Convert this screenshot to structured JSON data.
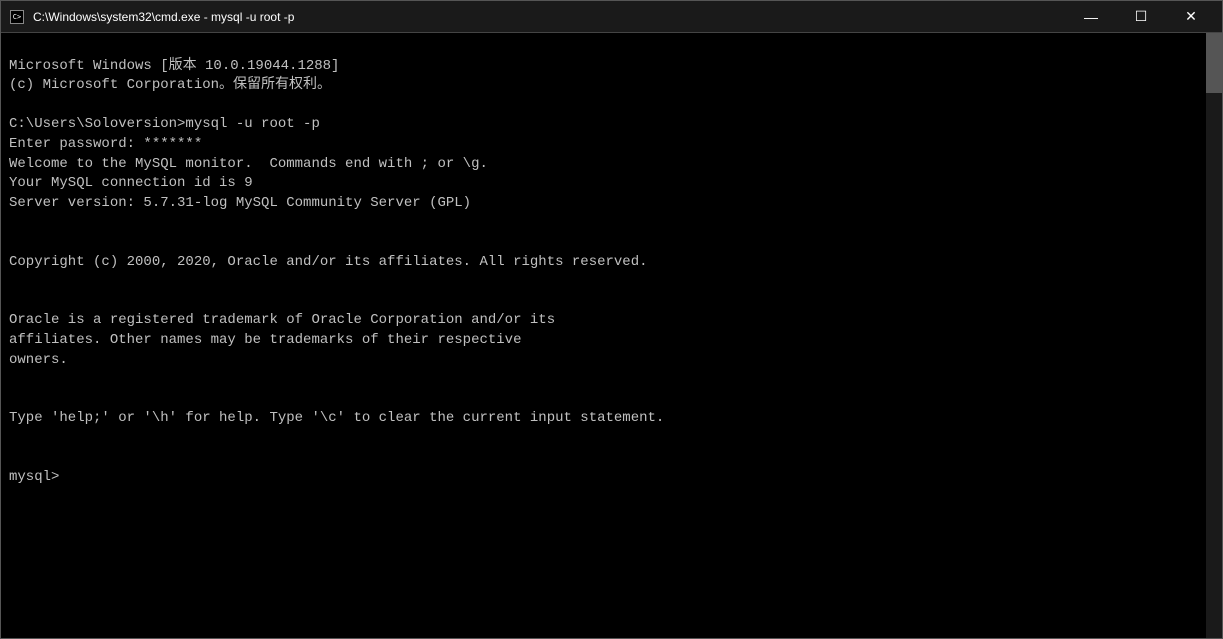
{
  "window": {
    "title": "C:\\Windows\\system32\\cmd.exe - mysql  -u root -p",
    "min_btn": "—",
    "max_btn": "☐",
    "close_btn": "✕"
  },
  "terminal": {
    "lines": [
      {
        "text": "Microsoft Windows [版本 10.0.19044.1288]",
        "type": "normal"
      },
      {
        "text": "(c) Microsoft Corporation。保留所有权利。",
        "type": "normal"
      },
      {
        "text": "",
        "type": "normal"
      },
      {
        "text": "C:\\Users\\Soloversion>mysql -u root -p",
        "type": "normal"
      },
      {
        "text": "Enter password: *******",
        "type": "normal"
      },
      {
        "text": "Welcome to the MySQL monitor.  Commands end with ; or \\g.",
        "type": "normal"
      },
      {
        "text": "Your MySQL connection id is 9",
        "type": "normal"
      },
      {
        "text": "Server version: 5.7.31-log MySQL Community Server (GPL)",
        "type": "normal"
      },
      {
        "text": "",
        "type": "normal"
      },
      {
        "text": "Copyright (c) 2000, 2020, Oracle and/or its affiliates. All rights reserved.",
        "type": "normal"
      },
      {
        "text": "",
        "type": "normal"
      },
      {
        "text": "Oracle is a registered trademark of Oracle Corporation and/or its",
        "type": "normal"
      },
      {
        "text": "affiliates. Other names may be trademarks of their respective",
        "type": "normal"
      },
      {
        "text": "owners.",
        "type": "normal"
      },
      {
        "text": "",
        "type": "normal"
      },
      {
        "text": "Type 'help;' or '\\h' for help. Type '\\c' to clear the current input statement.",
        "type": "normal"
      },
      {
        "text": "",
        "type": "normal"
      },
      {
        "text": "mysql> ",
        "type": "normal"
      }
    ]
  }
}
